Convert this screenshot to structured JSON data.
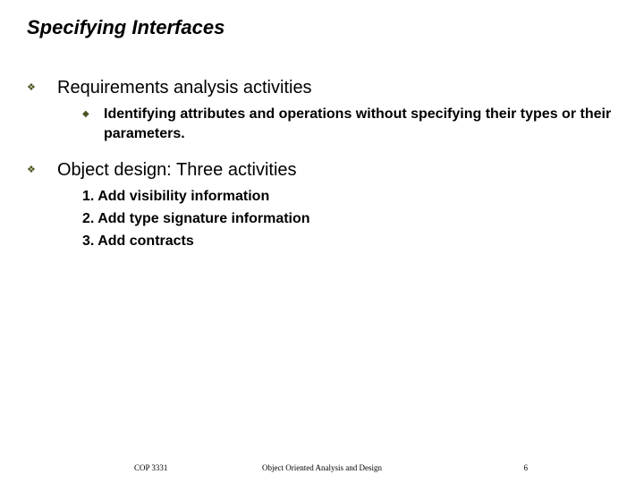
{
  "title": "Specifying Interfaces",
  "sections": [
    {
      "heading": "Requirements analysis activities",
      "sub": [
        "Identifying attributes and operations without specifying their types or their parameters."
      ]
    },
    {
      "heading": "Object design: Three activities",
      "numbered": [
        "Add visibility information",
        "Add type signature information",
        "Add contracts"
      ]
    }
  ],
  "footer": {
    "left": "COP 3331",
    "center": "Object Oriented Analysis and Design",
    "right": "6"
  },
  "bullets": {
    "level1": "❖",
    "level2": "◆"
  }
}
